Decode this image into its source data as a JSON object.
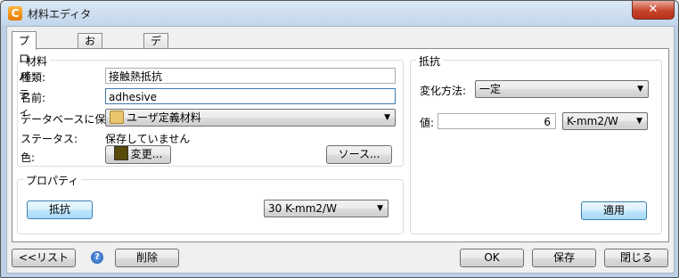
{
  "window": {
    "title": "材料エディタ",
    "close_label": "✕",
    "app_icon_glyph": "C"
  },
  "tabs": [
    {
      "label": "プロパティ"
    },
    {
      "label": "お気に入り"
    },
    {
      "label": "データベース"
    }
  ],
  "material": {
    "legend": "材料",
    "type_label": "種類:",
    "type_value": "接触熱抵抗",
    "name_label": "名前:",
    "name_value": "adhesive",
    "save_db_label": "データベースに保存:",
    "save_db_value": "ユーザ定義材料",
    "status_label": "ステータス:",
    "status_value": "保存していません",
    "color_label": "色:",
    "color_value": "#5a4a0a",
    "change_button": "変更...",
    "source_button": "ソース..."
  },
  "properties": {
    "legend": "プロパティ",
    "resistance_button": "抵抗",
    "unit_value": "30 K-mm2/W"
  },
  "resistance": {
    "legend": "抵抗",
    "variation_label": "変化方法:",
    "variation_value": "一定",
    "value_label": "値:",
    "value": "6",
    "unit_value": "K-mm2/W",
    "apply_button": "適用"
  },
  "footer": {
    "list_button": "<<リスト",
    "delete_button": "削除",
    "ok_button": "OK",
    "save_button": "保存",
    "close_button": "閉じる"
  },
  "icons": {
    "app": "app-icon",
    "help": "help-icon",
    "database": "database-folder-icon",
    "dropdown": "chevron-down-icon"
  }
}
